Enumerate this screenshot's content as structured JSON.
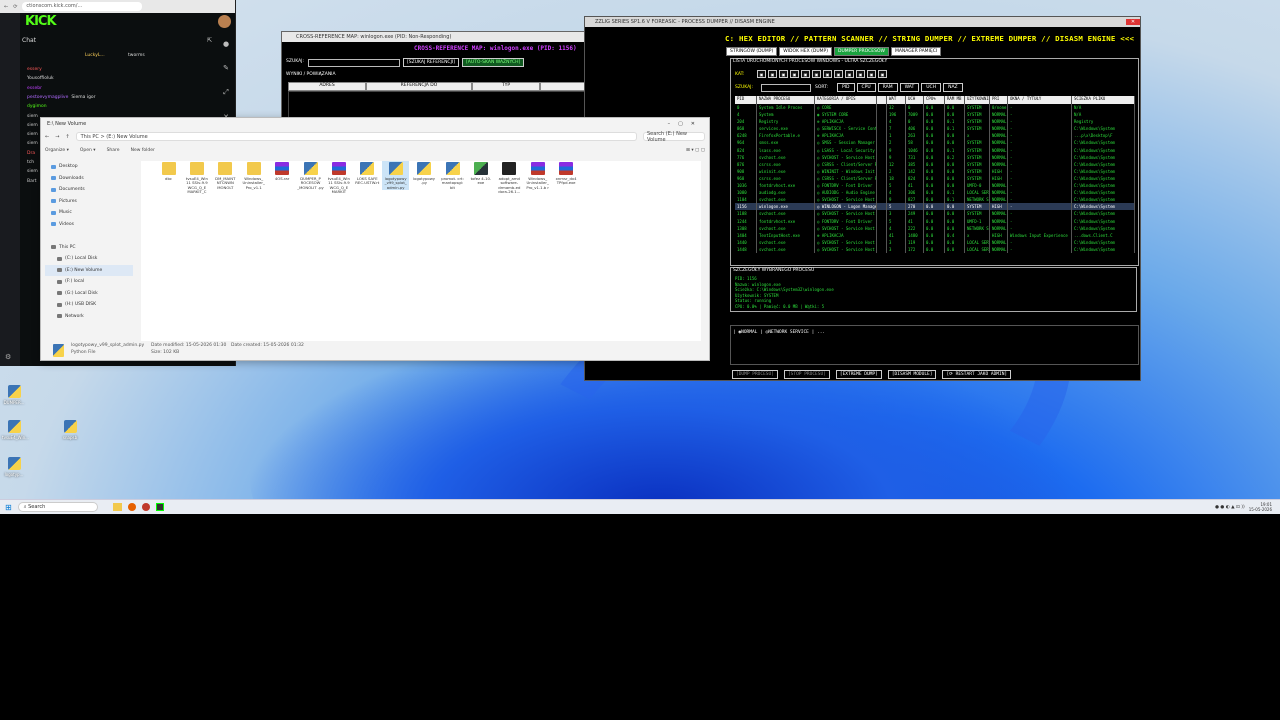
{
  "kick": {
    "url": "ctionscom.kick.com/...",
    "logo": "KICK",
    "chat_title": "Chat",
    "chat_header_user": "LuckyL...",
    "chat_header_other": "tworms",
    "messages": [
      {
        "user": "essery",
        "text": "",
        "color": "#ff5a5a"
      },
      {
        "user": "Yousoffioluk",
        "text": "",
        "color": "#d8d8d8"
      },
      {
        "user": "essebr",
        "text": "",
        "color": "#c040ff"
      },
      {
        "user": "pestoevymagplive",
        "text": "Siema igor",
        "color": "#b06aff"
      },
      {
        "user": "dygimon",
        "text": "",
        "color": "#53fc18"
      },
      {
        "user": "siem",
        "text": "",
        "color": "#cccccc"
      },
      {
        "user": "siem",
        "text": "",
        "color": "#cccccc"
      },
      {
        "user": "siem",
        "text": "",
        "color": "#cccccc"
      },
      {
        "user": "siem",
        "text": "",
        "color": "#cccccc"
      },
      {
        "user": "Dra",
        "text": "",
        "color": "#ff5a5a"
      },
      {
        "user": "tch",
        "text": "",
        "color": "#cccccc"
      },
      {
        "user": "siem",
        "text": "",
        "color": "#cccccc"
      },
      {
        "user": "Bart",
        "text": "",
        "color": "#cccccc"
      }
    ]
  },
  "explorer": {
    "title": "E:\\ New Volume",
    "path": "This PC  >  (E:) New Volume",
    "search_placeholder": "Search (E:) New Volume",
    "commands": [
      "Organize ▾",
      "Open ▾",
      "Share",
      "New folder"
    ],
    "nav": [
      "Desktop",
      "Downloads",
      "Documents",
      "Pictures",
      "Music",
      "Videos",
      "",
      "This PC",
      "(C:) Local Disk",
      "(E:) New Volume",
      "(F:) local",
      "(G:) Local Disk",
      "(H:) USB DISK",
      "Network"
    ],
    "files": [
      {
        "name": "dbc",
        "type": "folder"
      },
      {
        "name": "tvsuE4_Win 11 SSIv-9.9 WCG_Q_E MARKIT_C",
        "type": "folder"
      },
      {
        "name": "DM_MAINT NTCNWN MONOLT",
        "type": "folder"
      },
      {
        "name": "Windows_ Uninstaller_ Pro_v1.1",
        "type": "folder"
      },
      {
        "name": "4OS.rar",
        "type": "rar"
      },
      {
        "name": "DUMPER_P ROCESOW _MONOLIT .py",
        "type": "py"
      },
      {
        "name": "tvsuE4_Win 11 SSIv-9.9 WCG_Q_E MARKIT",
        "type": "rar"
      },
      {
        "name": "LOKS SAFE REC.USTW.rt",
        "type": "py"
      },
      {
        "name": "logotypowy _v99_splot_ admin.py",
        "type": "py",
        "selected": true
      },
      {
        "name": "logotypowy .py",
        "type": "py"
      },
      {
        "name": "promot. crt: mantopsgi: bit",
        "type": "py"
      },
      {
        "name": "tofez 4-10. exe",
        "type": "exe"
      },
      {
        "name": "adopt_amd software- drmamb-ed dora-26.1...",
        "type": "exe2"
      },
      {
        "name": "Windows_ Uninstaller_ Pro_v1.1.b r",
        "type": "rar"
      },
      {
        "name": "xnmsr_dx4 TPfpd.exe",
        "type": "rar"
      }
    ],
    "status_file": "logotypowy_v99_splot_admin.py",
    "status_modified": "Date modified: 15-05-2026 01:30",
    "status_created": "Date created: 15-05-2026 01:32",
    "status_type": "Python File",
    "status_size": "Size: 102 KB"
  },
  "xref": {
    "title": "CROSS-REFERENCE MAP: winlogon.exe (PID: 1156)",
    "window_title": "CROSS-REFERENCE MAP: winlogon.exe (PID: Non-Responding)",
    "search_label": "SZUKAJ:",
    "btn_search": "[SZUKAJ REFERENCJI]",
    "btn_auto": "[AUTO-SKAN WAŻNYCH]",
    "results_label": "WYNIKI / POWIĄZANIA",
    "columns": [
      "ADRES",
      "REFERENCJA DO",
      "TYP",
      "KONTEKST"
    ]
  },
  "dumper": {
    "window_title": "ZZLIG SERIES SP1.6 V FOREASIC - PROCESS DUMPER // DISASM ENGINE",
    "banner": "C: HEX EDITOR // PATTERN SCANNER // STRING DUMPER // EXTREME DUMPER // DISASM ENGINE <<<",
    "tabs": [
      "STRINGÓW (DUMP)",
      "WIDOK HEX (DUMP)",
      "DUMPER PROCESÓW",
      "MANAGER PAMIĘCI"
    ],
    "active_tab": 2,
    "panel_title": "LISTA URUCHOMIONYCH PROCESÓW WINDOWS - ULTRA SZCZEGÓŁY",
    "cat_label": "KAT:",
    "search_label": "SZUKAJ:",
    "sort_label": "SORT:",
    "sort_buttons": [
      "PID",
      "CPU",
      "RAM",
      "WAT",
      "UCH",
      "NAZ"
    ],
    "columns": [
      "PID",
      "NAZWA PROCESU",
      "KATEGORIA / OPIS",
      "",
      "WAT",
      "UCH",
      "CPU%",
      "RAM MB",
      "UŻYTKOWNIK",
      "PRI",
      "OKNA / TYTUŁY",
      "ŚCIEŻKA PLIKU"
    ],
    "rows": [
      [
        "0",
        "System Idle Proces",
        "◎ CORE",
        "",
        "32",
        "0",
        "0.0",
        "0.0",
        "SYSTEM",
        "0/none",
        "-",
        "N/A"
      ],
      [
        "4",
        "System",
        "◉ SYSTEM CORE",
        "",
        "196",
        "7009",
        "0.0",
        "0.0",
        "SYSTEM",
        "NORMAL",
        "-",
        "N/A"
      ],
      [
        "204",
        "Registry",
        "⊕ APLIKACJA",
        "",
        "4",
        "0",
        "0.0",
        "0.1",
        "SYSTEM",
        "NORMAL",
        "-",
        "Registry"
      ],
      [
        "868",
        "services.exe",
        "◎ SERWISCX - Service Contro",
        "",
        "7",
        "406",
        "0.0",
        "0.1",
        "SYSTEM",
        "NORMAL",
        "-",
        "C:\\Windows\\System"
      ],
      [
        "6248",
        "FirefoxPortable.e",
        "⊕ APLIKACJA",
        "",
        "1",
        "263",
        "0.0",
        "0.0",
        "x",
        "NORMAL",
        "-",
        "...p\\x\\Desktop\\F"
      ],
      [
        "964",
        "smss.exe",
        "◎ SMSS - Session Manager",
        "",
        "2",
        "58",
        "0.0",
        "0.0",
        "SYSTEM",
        "NORMAL",
        "-",
        "C:\\Windows\\System"
      ],
      [
        "824",
        "lsass.exe",
        "◎ LSASS - Local Security Au",
        "",
        "9",
        "1046",
        "0.0",
        "0.1",
        "SYSTEM",
        "NORMAL",
        "-",
        "C:\\Windows\\System"
      ],
      [
        "776",
        "svchost.exe",
        "◎ SVCHOST - Service Host",
        "",
        "9",
        "731",
        "0.0",
        "0.2",
        "SYSTEM",
        "NORMAL",
        "-",
        "C:\\Windows\\System"
      ],
      [
        "876",
        "csrss.exe",
        "◎ CSRSS - Client/Server Ru",
        "",
        "12",
        "385",
        "0.0",
        "0.0",
        "SYSTEM",
        "NORMAL",
        "-",
        "C:\\Windows\\System"
      ],
      [
        "908",
        "wininit.exe",
        "◎ WININIT - Windows Init",
        "",
        "2",
        "142",
        "0.0",
        "0.0",
        "SYSTEM",
        "HIGH",
        "-",
        "C:\\Windows\\System"
      ],
      [
        "968",
        "csrss.exe",
        "◎ CSRSS - Client/Server Ru",
        "",
        "18",
        "824",
        "0.0",
        "0.0",
        "SYSTEM",
        "HIGH",
        "-",
        "C:\\Windows\\System"
      ],
      [
        "1036",
        "fontdrvhost.exe",
        "◎ FONTDRV - Font Driver",
        "",
        "5",
        "41",
        "0.0",
        "0.0",
        "UMFD-0",
        "NORMAL",
        "-",
        "C:\\Windows\\System"
      ],
      [
        "1080",
        "audiodg.exe",
        "◎ AUDIODG - Audio Engine",
        "",
        "4",
        "306",
        "0.0",
        "0.1",
        "LOCAL SERVICE",
        "NORMAL",
        "-",
        "C:\\Windows\\System"
      ],
      [
        "1104",
        "svchost.exe",
        "◎ SVCHOST - Service Host",
        "",
        "9",
        "827",
        "0.0",
        "0.1",
        "NETWORK SERVICE",
        "NORMAL",
        "-",
        "C:\\Windows\\System"
      ],
      [
        "1156",
        "winlogon.exe",
        "◎ WINLOGON - Logon Manager",
        "",
        "5",
        "270",
        "0.0",
        "0.0",
        "SYSTEM",
        "HIGH",
        "-",
        "C:\\Windows\\System"
      ],
      [
        "1188",
        "svchost.exe",
        "◎ SVCHOST - Service Host",
        "",
        "3",
        "249",
        "0.0",
        "0.0",
        "SYSTEM",
        "NORMAL",
        "-",
        "C:\\Windows\\System"
      ],
      [
        "1244",
        "fontdrvhost.exe",
        "◎ FONTDRV - Font Driver",
        "",
        "5",
        "41",
        "0.0",
        "0.0",
        "UMFD-1",
        "NORMAL",
        "-",
        "C:\\Windows\\System"
      ],
      [
        "1308",
        "svchost.exe",
        "◎ SVCHOST - Service Host",
        "",
        "4",
        "222",
        "0.0",
        "0.0",
        "NETWORK SERVICE",
        "NORMAL",
        "-",
        "C:\\Windows\\System"
      ],
      [
        "1404",
        "TextInputHost.exe",
        "⊕ APLIKACJA",
        "",
        "41",
        "1480",
        "0.0",
        "0.4",
        "x",
        "HIGH",
        "Windows Input Experience",
        "...dows.Client.C"
      ],
      [
        "1440",
        "svchost.exe",
        "◎ SVCHOST - Service Host",
        "",
        "3",
        "119",
        "0.0",
        "0.0",
        "LOCAL SERVICE",
        "NORMAL",
        "-",
        "C:\\Windows\\System"
      ],
      [
        "1448",
        "svchost.exe",
        "◎ SVCHOST - Service Host",
        "",
        "3",
        "172",
        "0.0",
        "0.0",
        "LOCAL SERVICE",
        "NORMAL",
        "-",
        "C:\\Windows\\System"
      ]
    ],
    "selected_row": 14,
    "details_title": "SZCZEGÓŁY WYBRANEGO PROCESU",
    "details": [
      "PID: 1156",
      "Nazwa: winlogon.exe",
      "Ścieżka: C:\\Windows\\System32\\winlogon.exe",
      "Użytkownik: SYSTEM",
      "Status: running",
      "CPU: 0.0% | Pamięć: 0.0 MB | Wątki: 5"
    ],
    "legend": "| ◉NORMAL | ◎NETWORK SERVICE | ...",
    "bottom_buttons": [
      "[DUMP PROCESU]",
      "[STOP PROCESU]",
      "[EXTREME DUMP]",
      "[DISASM MODULE]",
      "[⟳ RESTART JAKO ADMIN]"
    ]
  },
  "desktop_icons": [
    "DUMPER...",
    "tvsuE4_Win...",
    "logotyp...",
    "snapsb"
  ],
  "taskbar": {
    "search_placeholder": "Search",
    "time": "19:01",
    "date": "15-05-2026"
  }
}
